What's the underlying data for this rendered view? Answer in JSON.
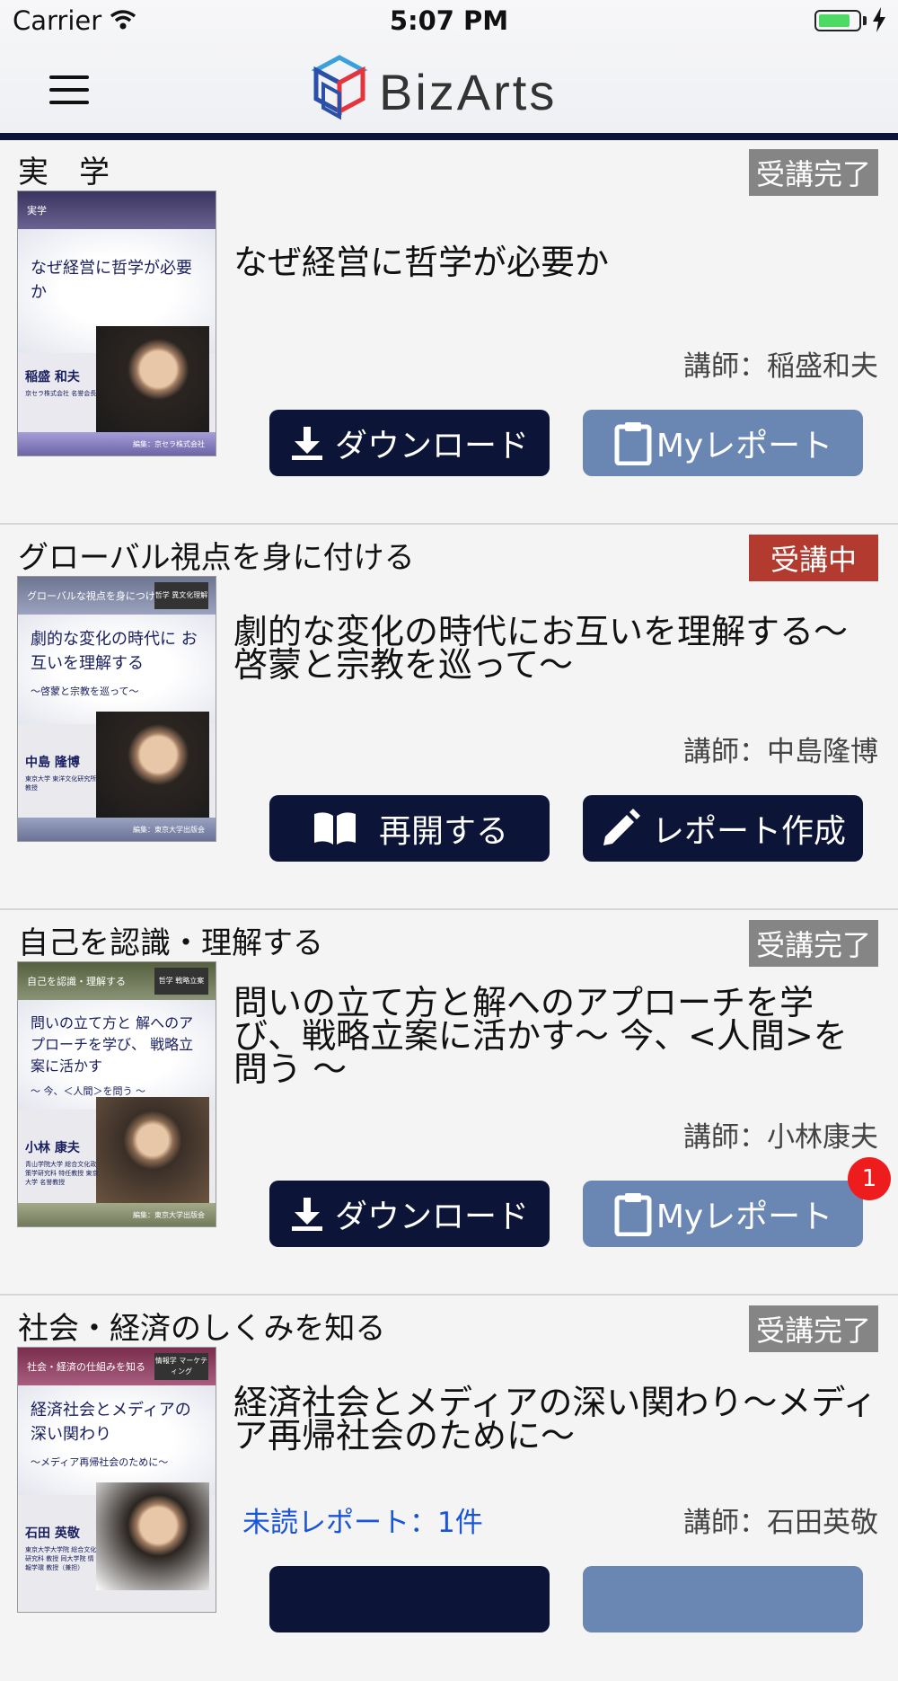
{
  "status_bar": {
    "carrier": "Carrier",
    "time": "5:07 PM",
    "battery_level": 0.8,
    "battery_color": "#4cd964"
  },
  "header": {
    "logo_text": "BizArts",
    "menu_icon": "hamburger-menu-icon",
    "accent_color": "#0c1437"
  },
  "courses": [
    {
      "category": "実　学",
      "status": "受講完了",
      "thumbnail": {
        "header": "実学",
        "title": "なぜ経営に哲学が必要か",
        "subtitle": "",
        "lecturer_name": "稲盛 和夫",
        "affiliation": "京セラ株式会社 名誉会長",
        "footer": "編集：京セラ株式会社",
        "tag": ""
      },
      "lesson_title": "なぜ経営に哲学が必要か",
      "lecturer": "講師：稲盛和夫",
      "unread": "",
      "buttons": {
        "left": "ダウンロード",
        "right": "Myレポート"
      },
      "notification_count": ""
    },
    {
      "category": "グローバル視点を身に付ける",
      "status": "受講中",
      "thumbnail": {
        "header": "グローバルな視点を身につける",
        "title": "劇的な変化の時代に お互いを理解する",
        "subtitle": "〜啓蒙と宗教を巡って〜",
        "lecturer_name": "中島 隆博",
        "affiliation": "東京大学 東洋文化研究所 教授",
        "footer": "編集：東京大学出版会",
        "tag": "哲学 異文化理解"
      },
      "lesson_title": "劇的な変化の時代にお互いを理解する〜啓蒙と宗教を巡って〜",
      "lecturer": "講師：中島隆博",
      "unread": "",
      "buttons": {
        "left": "再開する",
        "right": "レポート作成"
      },
      "notification_count": ""
    },
    {
      "category": "自己を認識・理解する",
      "status": "受講完了",
      "thumbnail": {
        "header": "自己を認識・理解する",
        "title": "問いの立て方と 解へのアプローチを学び、 戦略立案に活かす",
        "subtitle": "〜 今、＜人間＞を問う 〜",
        "lecturer_name": "小林 康夫",
        "affiliation": "青山学院大学 総合文化政策学研究科 特任教授 東京大学 名誉教授",
        "footer": "編集：東京大学出版会",
        "tag": "哲学 戦略立案"
      },
      "lesson_title": "問いの立て方と解へのアプローチを学び、戦略立案に活かす〜 今、<人間>を問う 〜",
      "lecturer": "講師：小林康夫",
      "unread": "",
      "buttons": {
        "left": "ダウンロード",
        "right": "Myレポート"
      },
      "notification_count": "1"
    },
    {
      "category": "社会・経済のしくみを知る",
      "status": "受講完了",
      "thumbnail": {
        "header": "社会・経済の仕組みを知る",
        "title": "経済社会とメディアの 深い関わり",
        "subtitle": "〜メディア再帰社会のために〜",
        "lecturer_name": "石田 英敬",
        "affiliation": "東京大学大学院 総合文化研究科 教授 同大学院 情報学環 教授（兼担）",
        "footer": "",
        "tag": "情報学 マーケティング"
      },
      "lesson_title": "経済社会とメディアの深い関わり〜メディア再帰社会のために〜",
      "lecturer": "講師：石田英敬",
      "unread": "未読レポート：1件",
      "buttons": {
        "left": "",
        "right": ""
      },
      "notification_count": ""
    }
  ]
}
